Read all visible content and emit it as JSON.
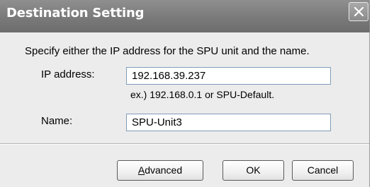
{
  "dialog": {
    "title": "Destination Setting",
    "instruction": "Specify either the IP address for the SPU unit and the name.",
    "ip": {
      "label": "IP address:",
      "value": "192.168.39.237",
      "hint": "ex.) 192.168.0.1 or SPU-Default."
    },
    "name": {
      "label": "Name:",
      "value": "SPU-Unit3"
    },
    "buttons": {
      "advanced_accel": "A",
      "advanced_rest": "dvanced",
      "ok": "OK",
      "cancel": "Cancel"
    }
  },
  "icons": {
    "close": "close-icon"
  }
}
